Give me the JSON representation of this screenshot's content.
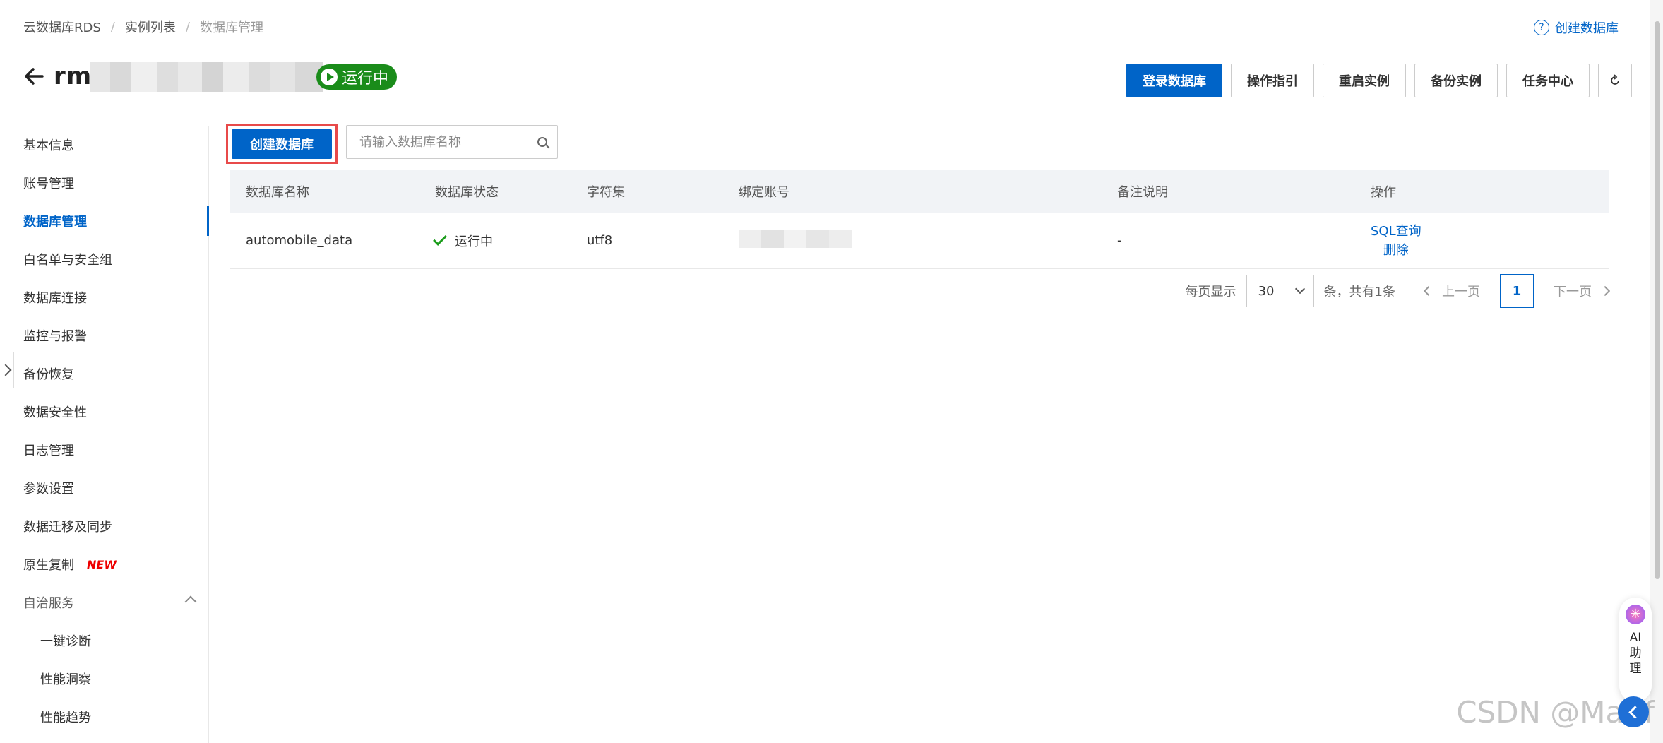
{
  "breadcrumb": {
    "items": [
      "云数据库RDS",
      "实例列表"
    ],
    "current": "数据库管理",
    "separator": "/"
  },
  "help_link": {
    "icon": "question-circle-icon",
    "label": "创建数据库"
  },
  "header": {
    "instance_id_prefix": "rm·",
    "status_label": "运行中",
    "status_color": "#1a8c1a"
  },
  "toolbar": {
    "login": "登录数据库",
    "guide": "操作指引",
    "restart": "重启实例",
    "backup": "备份实例",
    "tasks": "任务中心",
    "refresh_icon": "refresh-icon"
  },
  "sidebar": {
    "items": [
      {
        "label": "基本信息"
      },
      {
        "label": "账号管理"
      },
      {
        "label": "数据库管理",
        "active": true
      },
      {
        "label": "白名单与安全组"
      },
      {
        "label": "数据库连接"
      },
      {
        "label": "监控与报警"
      },
      {
        "label": "备份恢复"
      },
      {
        "label": "数据安全性"
      },
      {
        "label": "日志管理"
      },
      {
        "label": "参数设置"
      },
      {
        "label": "数据迁移及同步"
      },
      {
        "label": "原生复制",
        "badge": "NEW"
      },
      {
        "label": "自治服务"
      },
      {
        "label": "一键诊断"
      },
      {
        "label": "性能洞察"
      },
      {
        "label": "性能趋势"
      }
    ]
  },
  "main": {
    "create_button": "创建数据库",
    "search_placeholder": "请输入数据库名称",
    "table": {
      "headers": [
        "数据库名称",
        "数据库状态",
        "字符集",
        "绑定账号",
        "备注说明",
        "操作"
      ],
      "rows": [
        {
          "name": "automobile_data",
          "status": "运行中",
          "charset": "utf8",
          "remark": "-",
          "actions": [
            "SQL查询",
            "删除"
          ]
        }
      ]
    },
    "pagination": {
      "per_page_label": "每页显示",
      "page_size": "30",
      "total_label": "条，共有1条",
      "prev": "上一页",
      "current_page": "1",
      "next": "下一页"
    }
  },
  "ai_assistant": {
    "label": "AI\n助\n理"
  },
  "watermark": "CSDN @Marlf",
  "colors": {
    "primary": "#0064c8",
    "success": "#1a9c1a",
    "highlight_border": "#e84a4a"
  }
}
